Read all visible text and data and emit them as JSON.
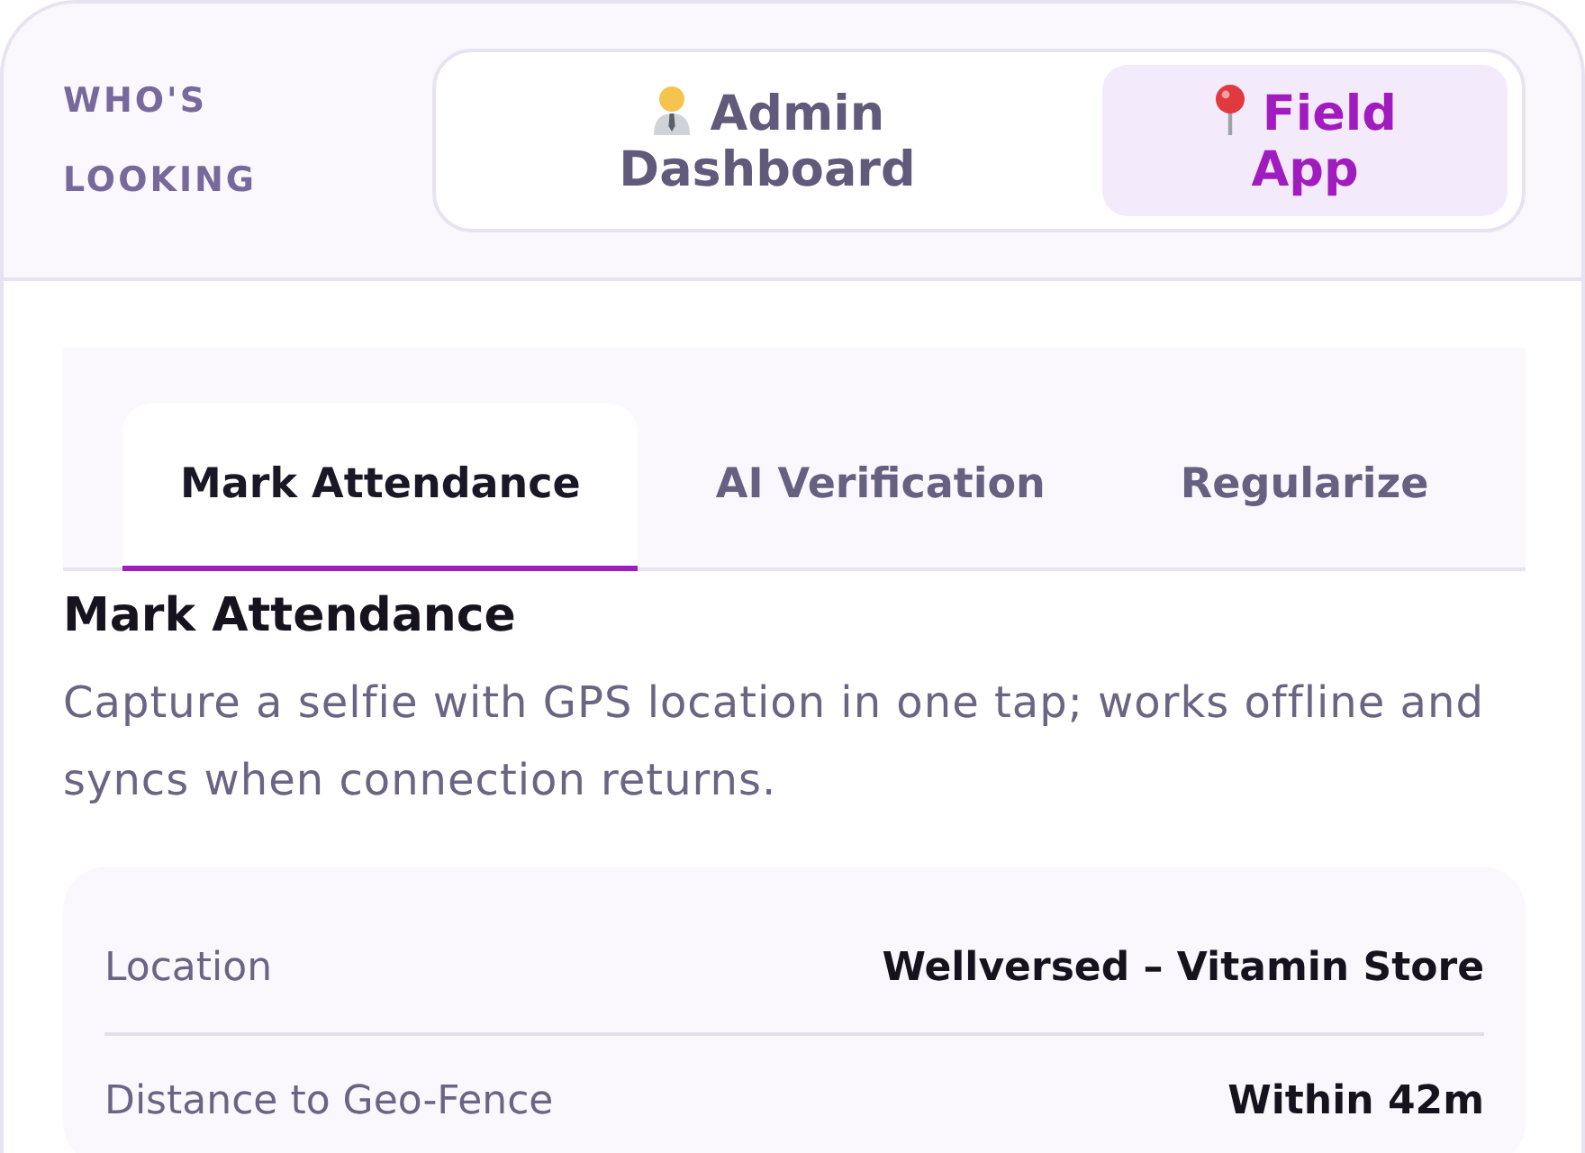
{
  "header": {
    "label": "WHO'S LOOKING",
    "views": [
      {
        "kind": "admin",
        "label": "Admin Dashboard",
        "selected": false
      },
      {
        "kind": "field",
        "label": "Field App",
        "selected": true
      }
    ]
  },
  "tabs": [
    {
      "label": "Mark Attendance",
      "selected": true
    },
    {
      "label": "AI Verification",
      "selected": false
    },
    {
      "label": "Regularize",
      "selected": false
    }
  ],
  "section": {
    "title": "Mark Attendance",
    "description": "Capture a selfie with GPS location in one tap; works offline and syncs when connection returns."
  },
  "details": [
    {
      "label": "Location",
      "value": "Wellversed – Vitamin Store"
    },
    {
      "label": "Distance to Geo-Fence",
      "value": "Within 42m"
    }
  ]
}
